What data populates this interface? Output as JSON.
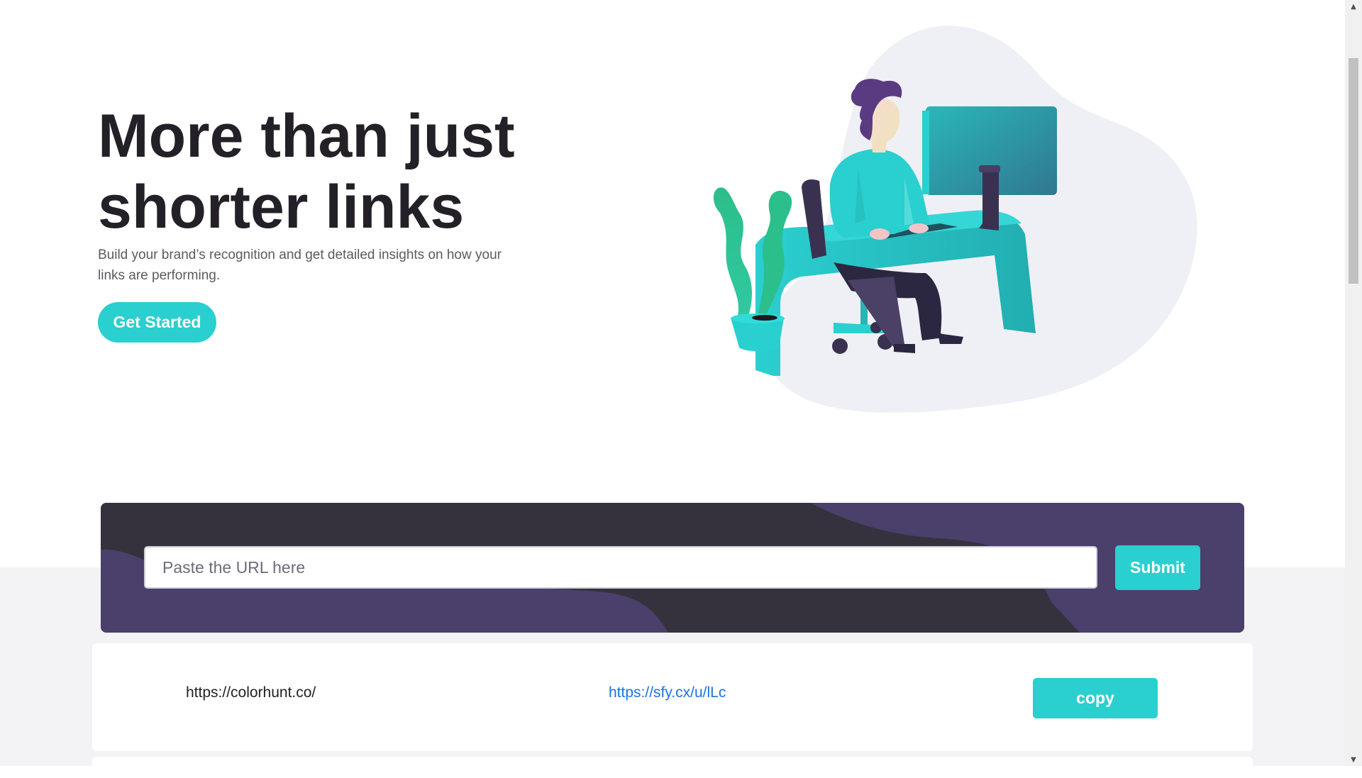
{
  "hero": {
    "title": "More than just shorter links",
    "subtitle": "Build your brand’s recognition and get detailed insights on how your links are performing.",
    "cta_label": "Get Started"
  },
  "shortener": {
    "placeholder": "Paste the URL here",
    "value": "",
    "submit_label": "Submit"
  },
  "results": [
    {
      "original": "https://colorhunt.co/",
      "short": "https://sfy.cx/u/lLc",
      "copy_label": "copy"
    }
  ],
  "colors": {
    "accent": "#2acfcf",
    "dark_violet": "#3b3054",
    "very_dark": "#232127",
    "band_gray": "#f3f3f6"
  },
  "scrollbar": {
    "up_icon": "▲",
    "down_icon": "▼"
  }
}
